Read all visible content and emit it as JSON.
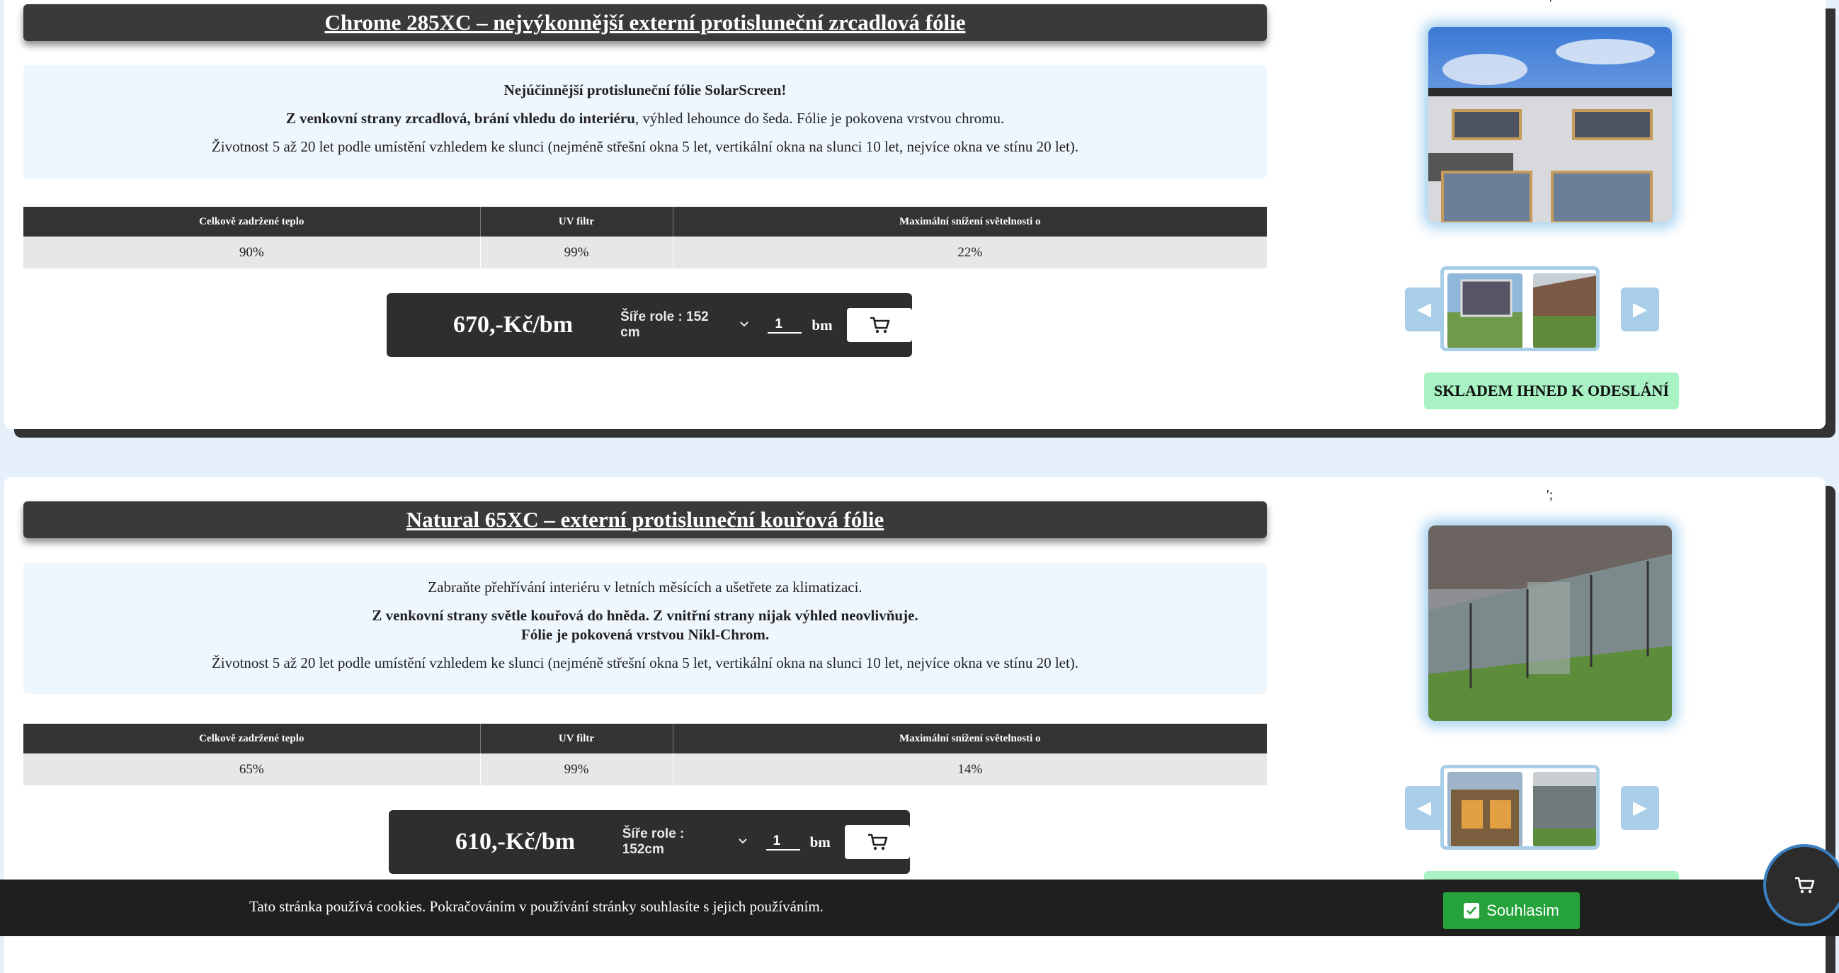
{
  "products": [
    {
      "title": "Chrome 285XC – nejvýkonnější externí protisluneční zrcadlová fólie",
      "desc_1": "Nejúčinnější protisluneční fólie SolarScreen!",
      "desc_2_bold": "Z venkovní strany zrcadlová, brání vhledu do interiéru",
      "desc_2_rest": ", výhled lehounce do šeda. Fólie je pokovena vrstvou chromu.",
      "desc_3": "Životnost 5 až 20 let podle umístění vzhledem ke slunci (nejméně střešní okna 5 let, vertikální okna na slunci 10 let, nejvíce okna ve stínu 20 let).",
      "spec_headers": [
        "Celkově zadržené teplo",
        "UV filtr",
        "Maximální snížení světelnosti o"
      ],
      "spec_values": [
        "90%",
        "99%",
        "22%"
      ],
      "price": "670,-Kč/bm",
      "roll_width": "Šíře role : 152 cm",
      "qty": "1",
      "unit": "bm",
      "stock": "SKLADEM IHNED K ODESLÁNÍ",
      "top_mark": "'"
    },
    {
      "title": "Natural 65XC – externí protisluneční kouřová fólie",
      "desc_1": "Zabraňte přehřívání interiéru v letních měsících a ušetřete za klimatizaci.",
      "desc_2_bold": "Z venkovní strany světle kouřová do hněda. Z vnitřní strany nijak výhled neovlivňuje.",
      "desc_2b_bold": "Fólie je pokovená vrstvou Nikl-Chrom.",
      "desc_3": "Životnost 5 až 20 let podle umístění vzhledem ke slunci (nejméně střešní okna 5 let, vertikální okna na slunci 10 let, nejvíce okna ve stínu 20 let).",
      "spec_headers": [
        "Celkově zadržené teplo",
        "UV filtr",
        "Maximální snížení světelnosti o"
      ],
      "spec_values": [
        "65%",
        "99%",
        "14%"
      ],
      "price": "610,-Kč/bm",
      "roll_width": "Šíře role : 152cm",
      "qty": "1",
      "unit": "bm",
      "top_mark": "';"
    }
  ],
  "cookie": {
    "text": "Tato stránka používá cookies. Pokračováním v používání stránky souhlasíte s jejich používáním.",
    "agree_label": "Souhlasim"
  },
  "icons": {
    "cart": "cart-icon",
    "prev": "arrow-left-icon",
    "next": "arrow-right-icon",
    "check": "check-icon",
    "chevron": "chevron-down-icon"
  },
  "colors": {
    "page_bg": "#e5f0fb",
    "dark_bar": "#3a3a3c",
    "stock_badge": "#a8f2c3",
    "agree_button": "#25a33a",
    "thumb_frame": "#a9cfe8"
  }
}
